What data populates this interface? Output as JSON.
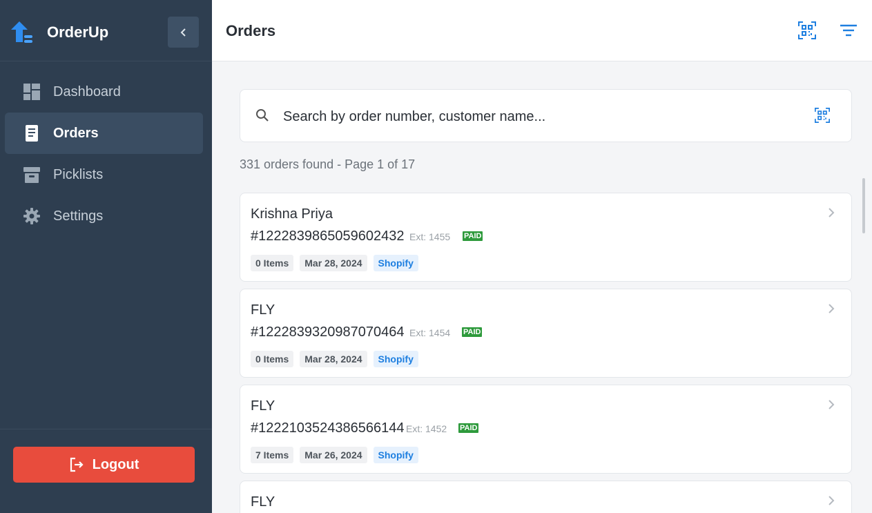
{
  "app": {
    "name": "OrderUp"
  },
  "nav": [
    {
      "label": "Dashboard",
      "icon": "dashboard-icon",
      "active": false
    },
    {
      "label": "Orders",
      "icon": "receipt-icon",
      "active": true
    },
    {
      "label": "Picklists",
      "icon": "archive-icon",
      "active": false
    },
    {
      "label": "Settings",
      "icon": "gear-icon",
      "active": false
    }
  ],
  "logout": {
    "label": "Logout"
  },
  "header": {
    "title": "Orders"
  },
  "search": {
    "placeholder": "Search by order number, customer name..."
  },
  "results": {
    "summary": "331 orders found - Page 1 of 17"
  },
  "orders": [
    {
      "customer": "Krishna Priya",
      "number": "#1222839865059602432",
      "ext": "Ext: 1455",
      "status": "PAID",
      "items": "0 Items",
      "date": "Mar 28, 2024",
      "source": "Shopify"
    },
    {
      "customer": "FLY",
      "number": "#1222839320987070464",
      "ext": "Ext: 1454",
      "status": "PAID",
      "items": "0 Items",
      "date": "Mar 28, 2024",
      "source": "Shopify"
    },
    {
      "customer": "FLY",
      "number": "#1222103524386566144",
      "ext": "Ext: 1452",
      "status": "PAID",
      "items": "7 Items",
      "date": "Mar 26, 2024",
      "source": "Shopify"
    },
    {
      "customer": "FLY"
    }
  ],
  "colors": {
    "sidebar": "#2e3e50",
    "accent": "#1e7fe0",
    "logout": "#e84c3d",
    "paid": "#2e9a3c"
  }
}
